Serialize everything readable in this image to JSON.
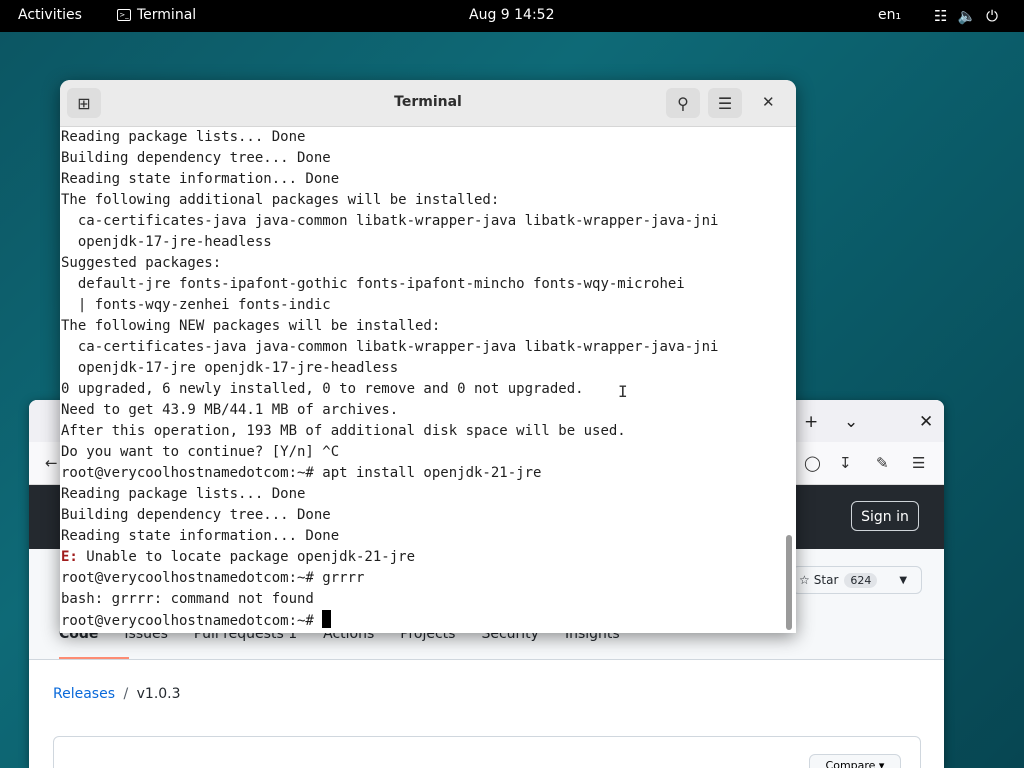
{
  "topbar": {
    "activities": "Activities",
    "app_name": "Terminal",
    "clock": "Aug 9  14:52",
    "lang": "en₁"
  },
  "terminal": {
    "title": "Terminal",
    "lines": [
      "Reading package lists... Done",
      "Building dependency tree... Done",
      "Reading state information... Done",
      "The following additional packages will be installed:",
      "  ca-certificates-java java-common libatk-wrapper-java libatk-wrapper-java-jni",
      "  openjdk-17-jre-headless",
      "Suggested packages:",
      "  default-jre fonts-ipafont-gothic fonts-ipafont-mincho fonts-wqy-microhei",
      "  | fonts-wqy-zenhei fonts-indic",
      "The following NEW packages will be installed:",
      "  ca-certificates-java java-common libatk-wrapper-java libatk-wrapper-java-jni",
      "  openjdk-17-jre openjdk-17-jre-headless",
      "0 upgraded, 6 newly installed, 0 to remove and 0 not upgraded.",
      "Need to get 43.9 MB/44.1 MB of archives.",
      "After this operation, 193 MB of additional disk space will be used.",
      "Do you want to continue? [Y/n] ^C",
      "root@verycoolhostnamedotcom:~# apt install openjdk-21-jre",
      "Reading package lists... Done",
      "Building dependency tree... Done",
      "Reading state information... Done"
    ],
    "error_prefix": "E:",
    "error_text": " Unable to locate package openjdk-21-jre",
    "after_lines": [
      "root@verycoolhostnamedotcom:~# grrrr",
      "bash: grrrr: command not found"
    ],
    "prompt": "root@verycoolhostnamedotcom:~# "
  },
  "browser": {
    "signin": "Sign in",
    "star_label": "Star",
    "star_count": "624",
    "tabs": {
      "code": "Code",
      "issues": "Issues",
      "pulls": "Pull requests",
      "pulls_count": "1",
      "actions": "Actions",
      "projects": "Projects",
      "security": "Security",
      "insights": "Insights"
    },
    "breadcrumb_link": "Releases",
    "breadcrumb_sep": "/",
    "breadcrumb_current": "v1.0.3",
    "compare": "Compare"
  },
  "colors": {
    "desktop": "#0e6a77",
    "github_header": "#24292f",
    "error": "#a01c1c"
  }
}
